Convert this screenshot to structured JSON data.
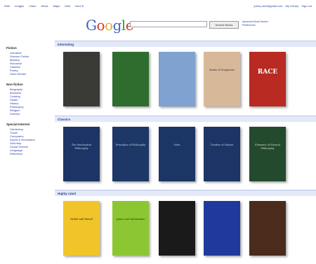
{
  "topnav": [
    "Web",
    "Images",
    "Video",
    "News",
    "Maps",
    "Mail",
    "more ▾"
  ],
  "toplinks": [
    "johnq.user@gmail.com",
    "My Library",
    "Sign out"
  ],
  "search": {
    "value": "",
    "button_label": "Search Books"
  },
  "adv_links": [
    "Advanced Book Search",
    "Preferences"
  ],
  "sidebar": [
    {
      "title": "Fiction",
      "items": [
        "Literature",
        "Science Fiction",
        "Mystery",
        "Romance",
        "Classics",
        "Poetry",
        "Short Stories"
      ]
    },
    {
      "title": "Non-fiction",
      "items": [
        "Biography",
        "Business",
        "Cooking",
        "Health",
        "History",
        "Philosophy",
        "Religion",
        "Science"
      ]
    },
    {
      "title": "Special Interest",
      "items": [
        "Gardening",
        "Travel",
        "Computers",
        "Sports & Recreation",
        "Self-Help",
        "Social Science",
        "Language",
        "Reference"
      ]
    }
  ],
  "sections": [
    {
      "title": "Interesting",
      "books": [
        {
          "title": "",
          "bg": "#3a3a36",
          "fg": "#eee"
        },
        {
          "title": "",
          "bg": "#2f6d2f",
          "fg": "#ddd"
        },
        {
          "title": "",
          "bg": "#7fa2d0",
          "fg": "#fff"
        },
        {
          "title": "Books of Fragments",
          "bg": "#d7b99a",
          "fg": "#333"
        },
        {
          "title": "RACE",
          "bg": "#b82a22",
          "fg": "#fff",
          "big": true
        }
      ]
    },
    {
      "title": "Classics",
      "books": [
        {
          "title": "The Mechanical Philosophy",
          "bg": "#1c3566",
          "fg": "#c8d2e6"
        },
        {
          "title": "Principles of Philosophy",
          "bg": "#1d3767",
          "fg": "#c8d2e6"
        },
        {
          "title": "Odes",
          "bg": "#1b3564",
          "fg": "#c8d2e6"
        },
        {
          "title": "Treatise of Nature",
          "bg": "#1c3566",
          "fg": "#c8d2e6"
        },
        {
          "title": "Elements of Natural Philosophy",
          "bg": "#244a2d",
          "fg": "#d0dbc8"
        }
      ]
    },
    {
      "title": "Highly rated",
      "books": [
        {
          "title": "Nickel and Dimed",
          "bg": "#f1c52a",
          "fg": "#222"
        },
        {
          "title": "games and information",
          "bg": "#8cc733",
          "fg": "#1b3a08"
        },
        {
          "title": "",
          "bg": "#1a1a1a",
          "fg": "#ddd"
        },
        {
          "title": "",
          "bg": "#1f3a9c",
          "fg": "#fff"
        },
        {
          "title": "",
          "bg": "#4a2b1c",
          "fg": "#eee"
        }
      ]
    }
  ]
}
